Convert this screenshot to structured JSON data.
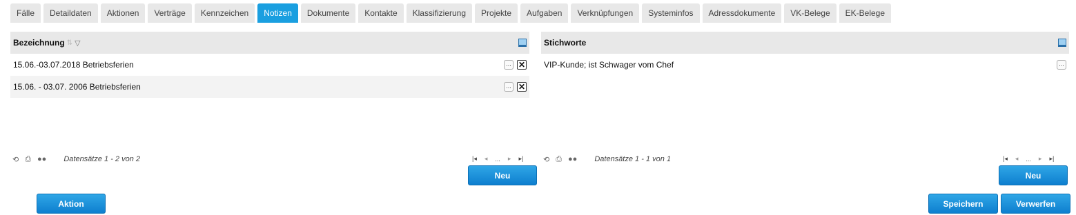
{
  "tabs": [
    {
      "label": "Fälle"
    },
    {
      "label": "Detaildaten"
    },
    {
      "label": "Aktionen"
    },
    {
      "label": "Verträge"
    },
    {
      "label": "Kennzeichen"
    },
    {
      "label": "Notizen",
      "active": true
    },
    {
      "label": "Dokumente"
    },
    {
      "label": "Kontakte"
    },
    {
      "label": "Klassifizierung"
    },
    {
      "label": "Projekte"
    },
    {
      "label": "Aufgaben"
    },
    {
      "label": "Verknüpfungen"
    },
    {
      "label": "Systeminfos"
    },
    {
      "label": "Adressdokumente"
    },
    {
      "label": "VK-Belege"
    },
    {
      "label": "EK-Belege"
    }
  ],
  "left_grid": {
    "header": "Bezeichnung",
    "rows": [
      {
        "text": "15.06.-03.07.2018 Betriebsferien"
      },
      {
        "text": "15.06. - 03.07. 2006 Betriebsferien"
      }
    ],
    "records": "Datensätze 1 - 2 von 2",
    "new_label": "Neu"
  },
  "right_grid": {
    "header": "Stichworte",
    "rows": [
      {
        "text": "VIP-Kunde; ist Schwager vom Chef"
      }
    ],
    "records": "Datensätze 1 - 1 von 1",
    "new_label": "Neu"
  },
  "row_buttons": {
    "more": "...",
    "delete": "✕"
  },
  "pager": {
    "first": "|◂",
    "prev": "◂",
    "ellipsis": "...",
    "next": "▸",
    "last": "▸|"
  },
  "footer_buttons": {
    "action": "Aktion",
    "save": "Speichern",
    "discard": "Verwerfen"
  },
  "colors": {
    "accent": "#1a9fe0",
    "tab_bg": "#e8e8e8",
    "header_bg": "#e8e8e8"
  }
}
